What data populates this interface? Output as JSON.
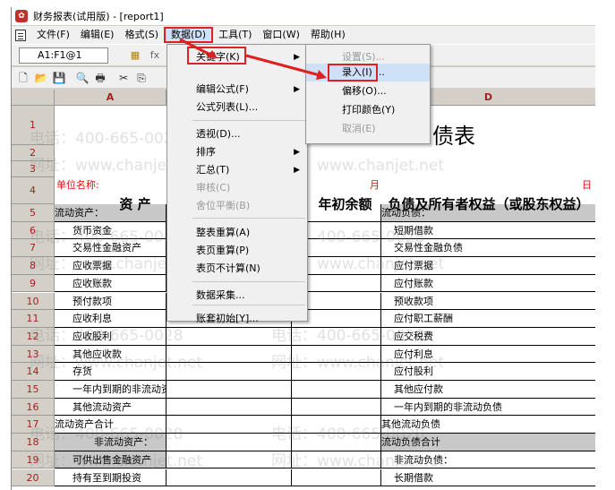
{
  "title": "财务报表(试用版) - [report1]",
  "menu": [
    "文件(F)",
    "编辑(E)",
    "格式(S)",
    "数据(D)",
    "工具(T)",
    "窗口(W)",
    "帮助(H)"
  ],
  "cell_ref": "A1:F1@1",
  "data_menu": {
    "items": [
      {
        "label": "关键字(K)",
        "arrow": "▶"
      },
      {
        "label": "编辑公式(F)",
        "arrow": "▶"
      },
      {
        "label": "公式列表(L)..."
      },
      {
        "label": "透视(D)..."
      },
      {
        "label": "排序",
        "arrow": "▶"
      },
      {
        "label": "汇总(T)",
        "arrow": "▶"
      },
      {
        "label": "审核(C)"
      },
      {
        "label": "舍位平衡(B)"
      },
      {
        "label": "整表重算(A)"
      },
      {
        "label": "表页重算(P)"
      },
      {
        "label": "表页不计算(N)"
      },
      {
        "label": "数据采集..."
      },
      {
        "label": "账套初始[Y]..."
      }
    ]
  },
  "keyword_menu": {
    "items": [
      {
        "label": "设置(S)..."
      },
      {
        "label": "录入(I) ..."
      },
      {
        "label": "偏移(O)..."
      },
      {
        "label": "打印颜色(Y)"
      },
      {
        "label": "取消(E)"
      }
    ]
  },
  "sheet": {
    "col_headers": [
      "A",
      "D"
    ],
    "title_fragment": "债表",
    "unit_label": "单位名称:",
    "month_label": "月",
    "day_label": "日",
    "header_asset": "资        产",
    "header_begin": "年初余额",
    "header_liab": "负债及所有者权益（或股东权益）",
    "rows": [
      {
        "num": "1"
      },
      {
        "num": "2"
      },
      {
        "num": "3"
      },
      {
        "num": "4"
      },
      {
        "num": "5",
        "a": "流动资产：",
        "d": "流动负债："
      },
      {
        "num": "6",
        "a": "货币资金",
        "d": "短期借款"
      },
      {
        "num": "7",
        "a": "交易性金融资产",
        "d": "交易性金融负债"
      },
      {
        "num": "8",
        "a": "应收票据",
        "d": "应付票据"
      },
      {
        "num": "9",
        "a": "应收账款",
        "d": "应付账款"
      },
      {
        "num": "10",
        "a": "预付款项",
        "d": "预收款项"
      },
      {
        "num": "11",
        "a": "应收利息",
        "d": "应付职工薪酬"
      },
      {
        "num": "12",
        "a": "应收股利",
        "d": "应交税费"
      },
      {
        "num": "13",
        "a": "其他应收款",
        "d": "应付利息"
      },
      {
        "num": "14",
        "a": "存货",
        "d": "应付股利"
      },
      {
        "num": "15",
        "a": "一年内到期的非流动资产",
        "d": "其他应付款"
      },
      {
        "num": "16",
        "a": "其他流动资产",
        "d": "一年内到期的非流动负债"
      },
      {
        "num": "17",
        "a": "流动资产合计",
        "d": "其他流动负债"
      },
      {
        "num": "18",
        "a": "非流动资产：",
        "d": "流动负债合计"
      },
      {
        "num": "19",
        "a": "可供出售金融资产",
        "d": "非流动负债："
      },
      {
        "num": "20",
        "a": "持有至到期投资",
        "d": "长期借款"
      }
    ]
  },
  "watermarks": {
    "phone": "电话：400-665-0028",
    "site": "网址：www.chanjet.net"
  }
}
